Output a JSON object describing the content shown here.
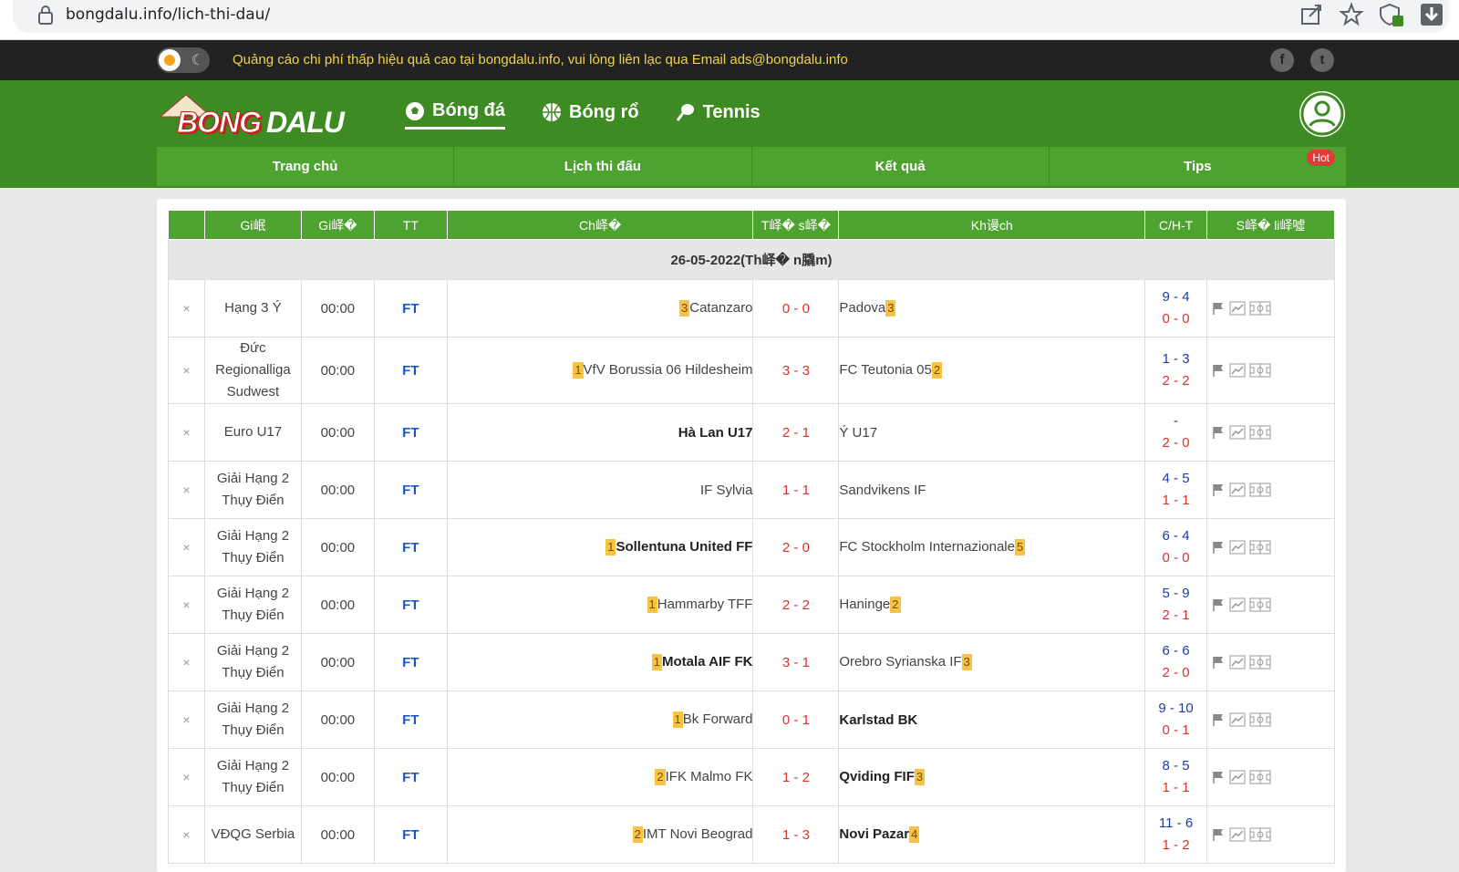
{
  "browser": {
    "url": "bongdalu.info/lich-thi-dau/"
  },
  "ad_bar": {
    "text": "Quảng cáo chi phí thấp hiệu quả cao tại bongdalu.info, vui lòng liên lạc qua Email ads@bongdalu.info",
    "moon_glyph": "☾",
    "facebook_glyph": "f",
    "twitter_glyph": "t"
  },
  "logo": {
    "part1": "BONG",
    "part2": "DALU"
  },
  "sports_nav": [
    {
      "label": "Bóng đá",
      "icon": "soccer-ball-icon"
    },
    {
      "label": "Bóng rổ",
      "icon": "basketball-icon"
    },
    {
      "label": "Tennis",
      "icon": "tennis-racket-icon"
    }
  ],
  "main_menu": [
    {
      "label": "Trang chủ"
    },
    {
      "label": "Lịch thi đấu"
    },
    {
      "label": "Kết quả"
    },
    {
      "label": "Tips",
      "badge": "Hot"
    }
  ],
  "table": {
    "headers": [
      "",
      "Gi岷",
      "Gi峄�",
      "TT",
      "Ch峄�",
      "T峄� s峄�",
      "Kh谩ch",
      "C/H-T",
      "S峄� li峄噓"
    ],
    "date_label": "26-05-2022(Th峄� n膬m)",
    "rows": [
      {
        "x": "×",
        "league": "Hạng 3 Ý",
        "time": "00:00",
        "status": "FT",
        "home_rank": "3",
        "home": "Catanzaro",
        "home_bold": false,
        "score": "0 - 0",
        "away": "Padova",
        "away_rank": "3",
        "away_bold": false,
        "cht_top": "9 - 4",
        "cht_bot": "0 - 0"
      },
      {
        "x": "×",
        "league": "Đức Regionalliga Sudwest",
        "time": "00:00",
        "status": "FT",
        "home_rank": "1",
        "home": "VfV Borussia 06 Hildesheim",
        "home_bold": false,
        "score": "3 - 3",
        "away": "FC Teutonia 05",
        "away_rank": "2",
        "away_bold": false,
        "cht_top": "1 - 3",
        "cht_bot": "2 - 2"
      },
      {
        "x": "×",
        "league": "Euro U17",
        "time": "00:00",
        "status": "FT",
        "home_rank": "",
        "home": "Hà Lan U17",
        "home_bold": true,
        "score": "2 - 1",
        "away": "Ý U17",
        "away_rank": "",
        "away_bold": false,
        "cht_top": "-",
        "cht_bot": "2 - 0"
      },
      {
        "x": "×",
        "league": "Giải Hạng 2 Thụy Điển",
        "time": "00:00",
        "status": "FT",
        "home_rank": "",
        "home": "IF Sylvia",
        "home_bold": false,
        "score": "1 - 1",
        "away": "Sandvikens IF",
        "away_rank": "",
        "away_bold": false,
        "cht_top": "4 - 5",
        "cht_bot": "1 - 1"
      },
      {
        "x": "×",
        "league": "Giải Hạng 2 Thụy Điển",
        "time": "00:00",
        "status": "FT",
        "home_rank": "1",
        "home": "Sollentuna United FF",
        "home_bold": true,
        "score": "2 - 0",
        "away": "FC Stockholm Internazionale",
        "away_rank": "5",
        "away_bold": false,
        "cht_top": "6 - 4",
        "cht_bot": "0 - 0"
      },
      {
        "x": "×",
        "league": "Giải Hạng 2 Thụy Điển",
        "time": "00:00",
        "status": "FT",
        "home_rank": "1",
        "home": "Hammarby TFF",
        "home_bold": false,
        "score": "2 - 2",
        "away": "Haninge",
        "away_rank": "2",
        "away_bold": false,
        "cht_top": "5 - 9",
        "cht_bot": "2 - 1"
      },
      {
        "x": "×",
        "league": "Giải Hạng 2 Thụy Điển",
        "time": "00:00",
        "status": "FT",
        "home_rank": "1",
        "home": "Motala AIF FK",
        "home_bold": true,
        "score": "3 - 1",
        "away": "Orebro Syrianska IF",
        "away_rank": "3",
        "away_bold": false,
        "cht_top": "6 - 6",
        "cht_bot": "2 - 0"
      },
      {
        "x": "×",
        "league": "Giải Hạng 2 Thụy Điển",
        "time": "00:00",
        "status": "FT",
        "home_rank": "1",
        "home": "Bk Forward",
        "home_bold": false,
        "score": "0 - 1",
        "away": "Karlstad BK",
        "away_rank": "",
        "away_bold": true,
        "cht_top": "9 - 10",
        "cht_bot": "0 - 1"
      },
      {
        "x": "×",
        "league": "Giải Hạng 2 Thụy Điển",
        "time": "00:00",
        "status": "FT",
        "home_rank": "2",
        "home": "IFK Malmo FK",
        "home_bold": false,
        "score": "1 - 2",
        "away": "Qviding FIF",
        "away_rank": "3",
        "away_bold": true,
        "cht_top": "8 - 5",
        "cht_bot": "1 - 1"
      },
      {
        "x": "×",
        "league": "VĐQG Serbia",
        "time": "00:00",
        "status": "FT",
        "home_rank": "2",
        "home": "IMT Novi Beograd",
        "home_bold": false,
        "score": "1 - 3",
        "away": "Novi Pazar",
        "away_rank": "4",
        "away_bold": true,
        "cht_top": "11 - 6",
        "cht_bot": "1 - 2"
      }
    ]
  }
}
